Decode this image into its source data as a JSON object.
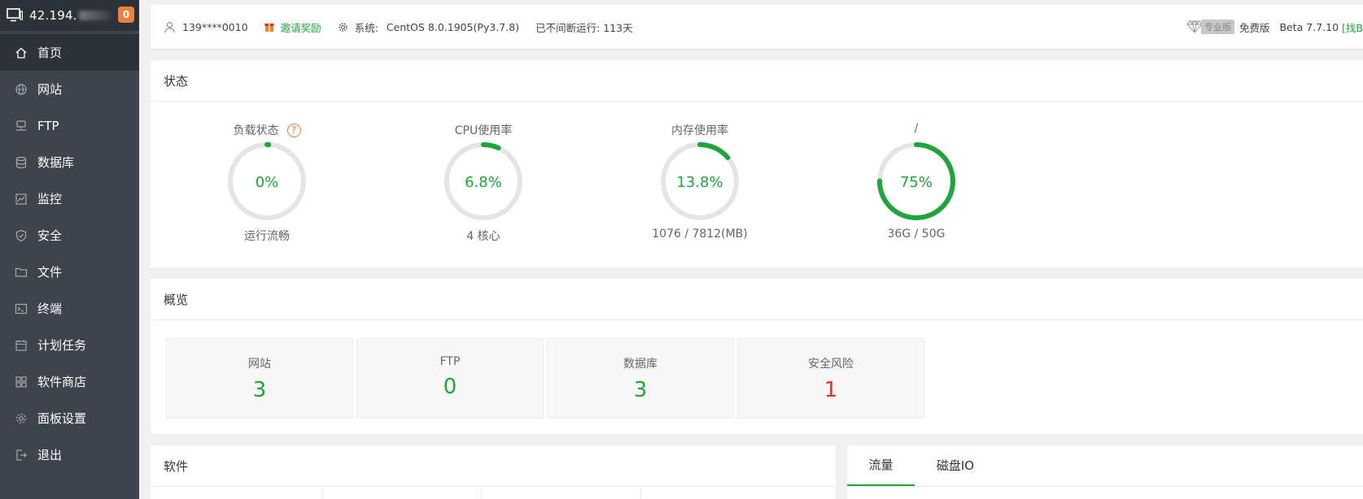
{
  "sidebar": {
    "ip": "42.194.",
    "notification_count": "0",
    "items": [
      {
        "label": "首页",
        "icon": "home-icon"
      },
      {
        "label": "网站",
        "icon": "globe-icon"
      },
      {
        "label": "FTP",
        "icon": "ftp-icon"
      },
      {
        "label": "数据库",
        "icon": "database-icon"
      },
      {
        "label": "监控",
        "icon": "monitor-icon"
      },
      {
        "label": "安全",
        "icon": "shield-icon"
      },
      {
        "label": "文件",
        "icon": "folder-icon"
      },
      {
        "label": "终端",
        "icon": "terminal-icon"
      },
      {
        "label": "计划任务",
        "icon": "calendar-icon"
      },
      {
        "label": "软件商店",
        "icon": "grid-icon"
      },
      {
        "label": "面板设置",
        "icon": "gear-icon"
      },
      {
        "label": "退出",
        "icon": "logout-icon"
      }
    ]
  },
  "topbar": {
    "user": "139****0010",
    "invite": "邀请奖励",
    "system_label": "系统:",
    "system_value": "CentOS 8.0.1905(Py3.7.8)",
    "uptime": "已不间断运行: 113天",
    "pro_label": "专业版",
    "free_label": "免费版",
    "version": "Beta  7.7.10",
    "version_link": "[找B"
  },
  "status": {
    "title": "状态",
    "gauges": [
      {
        "title": "负载状态",
        "value": "0%",
        "sub": "运行流畅",
        "percent": 0,
        "help": "?"
      },
      {
        "title": "CPU使用率",
        "value": "6.8%",
        "sub": "4 核心",
        "percent": 6.8
      },
      {
        "title": "内存使用率",
        "value": "13.8%",
        "sub": "1076 / 7812(MB)",
        "percent": 13.8
      },
      {
        "title": "/",
        "value": "75%",
        "sub": "36G / 50G",
        "percent": 75
      }
    ]
  },
  "overview": {
    "title": "概览",
    "cards": [
      {
        "label": "网站",
        "value": "3"
      },
      {
        "label": "FTP",
        "value": "0"
      },
      {
        "label": "数据库",
        "value": "3"
      },
      {
        "label": "安全风险",
        "value": "1"
      }
    ]
  },
  "software": {
    "title": "软件"
  },
  "traffic": {
    "tabs": [
      "流量",
      "磁盘IO"
    ]
  },
  "colors": {
    "accent": "#20a53a",
    "danger": "#e32c2c",
    "sidebar": "#3c444d",
    "badge": "#f0813c"
  }
}
